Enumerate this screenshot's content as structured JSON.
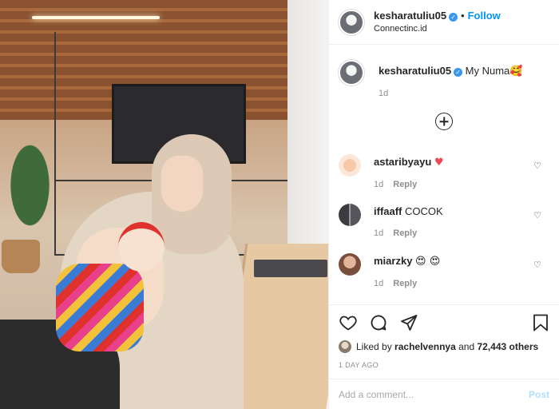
{
  "post": {
    "author": "kesharatuliu05",
    "follow_label": "Follow",
    "separator": "•",
    "location": "Connectinc.id",
    "caption_text": "My Numa",
    "caption_emoji": "🥰",
    "caption_time": "1d"
  },
  "comments": [
    {
      "user": "astaribyayu",
      "text": "",
      "emoji": "♥",
      "time": "1d",
      "reply_label": "Reply",
      "avatar_color": "#fde7d8"
    },
    {
      "user": "iffaaff",
      "text": "COCOK",
      "emoji": "",
      "time": "1d",
      "reply_label": "Reply",
      "avatar_color": "#dcdde3"
    },
    {
      "user": "miarzky",
      "text": "",
      "emoji": "😍 😍",
      "time": "1d",
      "reply_label": "Reply",
      "avatar_color": "#c9a08a"
    }
  ],
  "likes": {
    "liked_by_prefix": "Liked by",
    "user": "rachelvennya",
    "and": "and",
    "count": "72,443 others"
  },
  "posted_ago": "1 DAY AGO",
  "add_comment": {
    "placeholder": "Add a comment...",
    "post_label": "Post"
  },
  "colors": {
    "accent": "#0095f6",
    "verified": "#3897f0",
    "heart_red": "#ed4956"
  }
}
